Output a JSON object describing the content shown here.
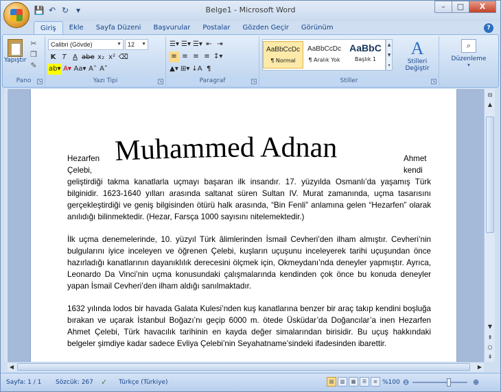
{
  "window": {
    "title": "Belge1 - Microsoft Word",
    "minimize": "–",
    "maximize": "□",
    "close": "X"
  },
  "qat": {
    "save": "💾",
    "undo": "↶",
    "redo": "↻",
    "more": "▾"
  },
  "tabs": [
    "Giriş",
    "Ekle",
    "Sayfa Düzeni",
    "Başvurular",
    "Postalar",
    "Gözden Geçir",
    "Görünüm"
  ],
  "help": "?",
  "ribbon": {
    "clipboard": {
      "paste_label": "Yapıştır",
      "group": "Pano"
    },
    "font": {
      "name": "Calibri (Gövde)",
      "size": "12",
      "group": "Yazı Tipi",
      "row1": [
        "K",
        "T",
        "A",
        "abe",
        "x₂",
        "x²",
        "⌫"
      ],
      "row2": [
        "ab▾",
        "A▾",
        "Aa▾",
        "A˄",
        "A˅"
      ]
    },
    "paragraph": {
      "group": "Paragraf",
      "row1": [
        "☰▾",
        "☰▾",
        "☰▾",
        "⇤",
        "⇥"
      ],
      "row2": [
        "≡",
        "≡",
        "≡",
        "≡",
        "↕▾"
      ],
      "row3": [
        "▲▾",
        "⊞▾",
        "↓A",
        "¶"
      ]
    },
    "styles": {
      "group": "Stiller",
      "items": [
        {
          "preview": "AaBbCcDc",
          "name": "¶ Normal"
        },
        {
          "preview": "AaBbCcDc",
          "name": "¶ Aralık Yok"
        },
        {
          "preview": "AaBbC",
          "name": "Başlık 1"
        }
      ],
      "change_label": "Stilleri Değiştir"
    },
    "editing": {
      "label": "Düzenleme"
    }
  },
  "document": {
    "wordart_title": "Muhammed Adnan",
    "side_left": [
      "Hezarfen",
      "Çelebi,"
    ],
    "side_right": [
      "Ahmet",
      "kendi"
    ],
    "para1": "geliştirdiği takma kanatlarla uçmayı başaran ilk insandır. 17. yüzyılda Osmanlı’da yaşamış Türk bilginidir. 1623-1640 yılları arasında saltanat süren Sultan IV. Murat zamanında, uçma tasarısını gerçekleştirdiği ve geniş bilgisinden ötürü halk arasında, “Bin Fenli” anlamına gelen “Hezarfen” olarak anılıdığı bilinmektedir. (Hezar, Farsça 1000 sayısını nitelemektedir.)",
    "para2": "İlk uçma denemelerinde, 10. yüzyıl Türk âlimlerinden İsmail Cevheri’den ilham almıştır. Cevheri’nin bulgularını iyice inceleyen ve öğrenen Çelebi, kuşların uçuşunu inceleyerek tarihi uçuşundan önce hazırladığı kanatlarının dayanıklılık derecesini ölçmek için, Okmeydanı’nda deneyler yapmıştır. Ayrıca, Leonardo Da Vinci’nin uçma konusundaki çalışmalarında kendinden çok önce bu konuda deneyler yapan İsmail Cevheri’den ilham aldığı sanılmaktadır.",
    "para3": "1632 yılında lodos bir havada Galata Kulesi’nden kuş kanatlarına benzer bir araç takıp kendini boşluğa bırakan ve uçarak İstanbul Boğazı’nı geçip 6000 m. ötede Üsküdar’da Doğancılar’a inen Hezarfen Ahmet Çelebi, Türk havacılık tarihinin en kayda değer simalarından birisidir. Bu uçuş hakkındaki belgeler şimdiye kadar sadece Evliya Çelebi’nin Seyahatname’sindeki ifadesinden ibarettir."
  },
  "status": {
    "page": "Sayfa: 1 / 1",
    "words": "Sözcük: 267",
    "language": "Türkçe (Türkiye)",
    "zoom": "%100"
  }
}
